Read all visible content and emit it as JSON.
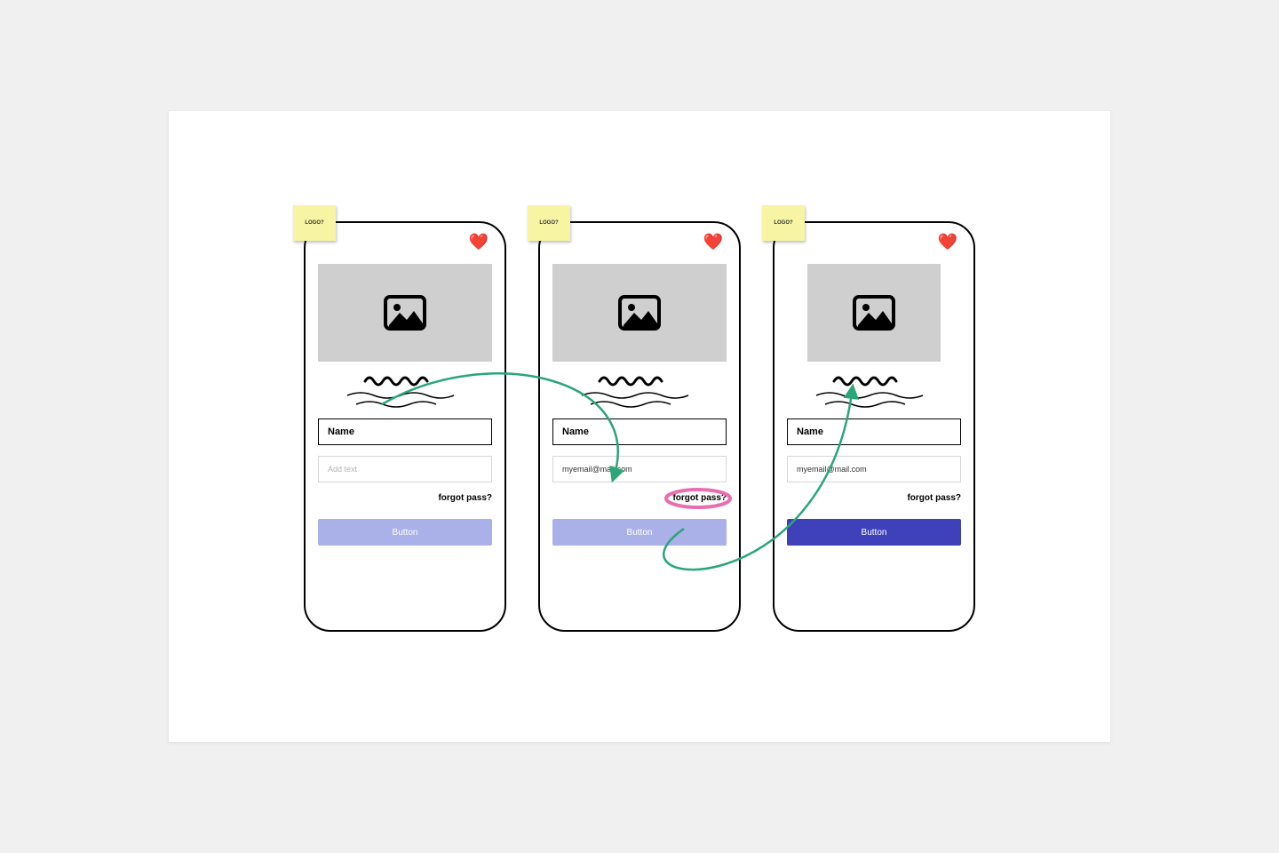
{
  "sticky_label": "LOGO?",
  "heart_glyph": "❤️",
  "screens": [
    {
      "name_label": "Name",
      "email_value": "Add text",
      "email_is_placeholder": true,
      "forgot_label": "forgot pass?",
      "button_label": "Button",
      "button_style": "muted",
      "hero_narrow": false,
      "forgot_circled": false
    },
    {
      "name_label": "Name",
      "email_value": "myemail@mail.com",
      "email_is_placeholder": false,
      "forgot_label": "forgot pass?",
      "button_label": "Button",
      "button_style": "muted",
      "hero_narrow": false,
      "forgot_circled": true
    },
    {
      "name_label": "Name",
      "email_value": "myemail@mail.com",
      "email_is_placeholder": false,
      "forgot_label": "forgot pass?",
      "button_label": "Button",
      "button_style": "strong",
      "hero_narrow": true,
      "forgot_circled": false
    }
  ],
  "colors": {
    "arrow": "#2ba57a",
    "circle": "#e86eb0"
  }
}
